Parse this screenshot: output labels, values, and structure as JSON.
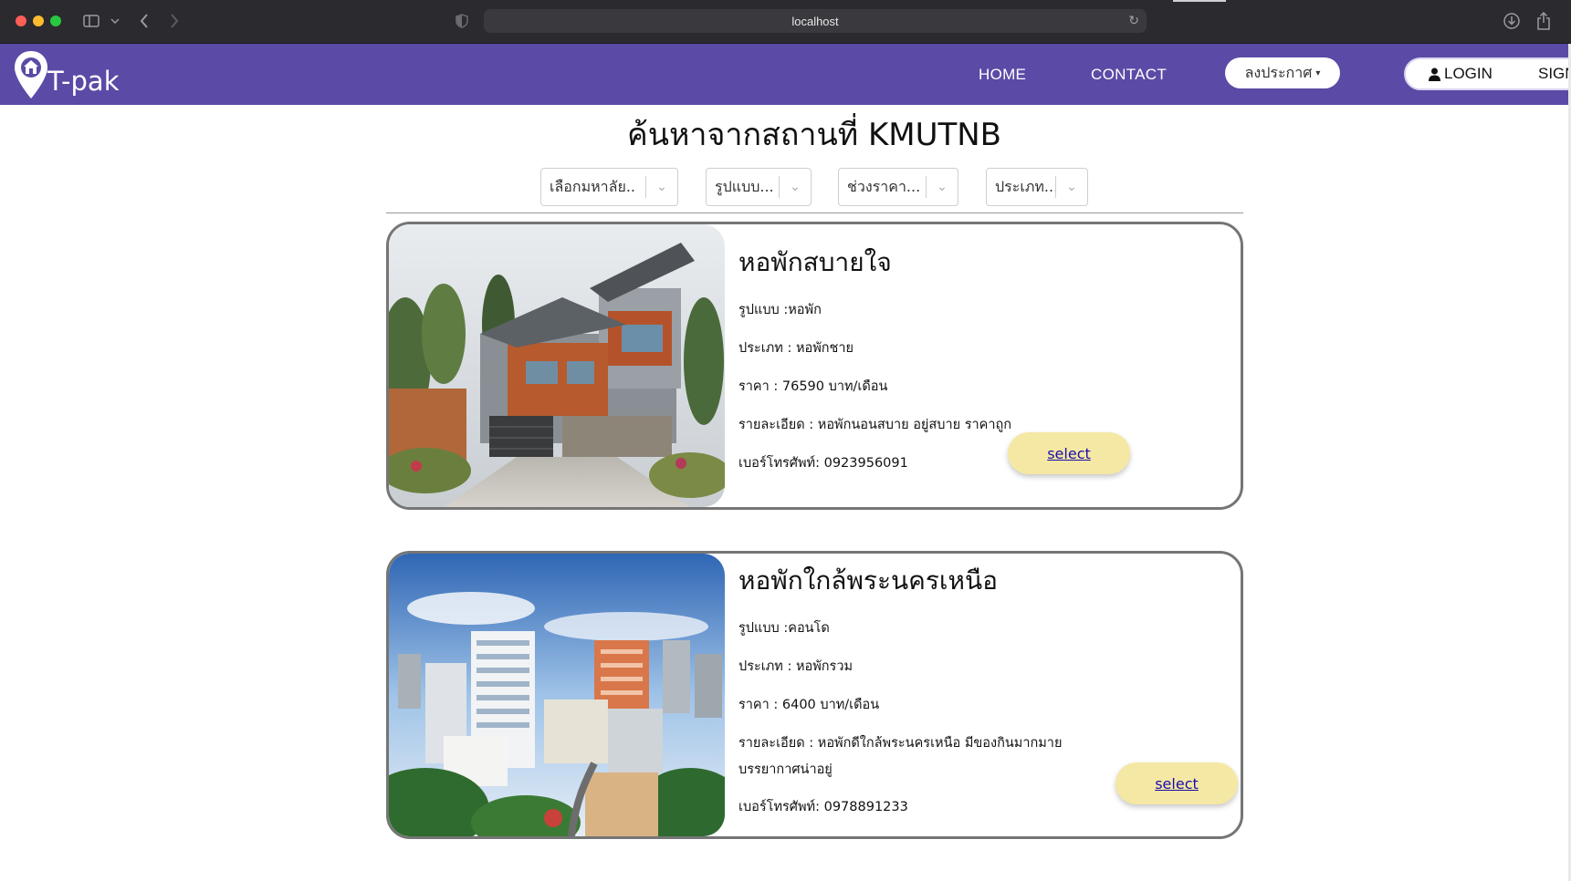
{
  "browser": {
    "url": "localhost",
    "icons": [
      "sidebar-icon",
      "chevron-down-icon",
      "back-icon",
      "forward-icon",
      "shield-icon",
      "reload-icon",
      "download-icon",
      "share-icon"
    ]
  },
  "nav": {
    "brand": "T-pak",
    "home": "HOME",
    "contact": "CONTACT",
    "post_label": "ลงประกาศ",
    "login": "LOGIN",
    "signup": "SIGN",
    "colors": {
      "navbar": "#5b4aa6",
      "select_button": "#f5e8a4"
    }
  },
  "page": {
    "title": "ค้นหาจากสถานที่ KMUTNB"
  },
  "filters": [
    {
      "label": "เลือกมหาลัย.."
    },
    {
      "label": "รูปแบบ..."
    },
    {
      "label": "ช่วงราคา..."
    },
    {
      "label": "ประเภท..."
    }
  ],
  "listings": [
    {
      "name": "หอพักสบายใจ",
      "style": "รูปแบบ :หอพัก",
      "type": "ประเภท : หอพักชาย",
      "price": "ราคา : 76590 บาท/เดือน",
      "detail": "รายละเอียด : หอพักนอนสบาย อยู่สบาย ราคาถูก",
      "detail2": "",
      "phone": "เบอร์โทรศัพท์: 0923956091",
      "select": "select"
    },
    {
      "name": "หอพักใกล้พระนครเหนือ",
      "style": "รูปแบบ :คอนโด",
      "type": "ประเภท : หอพักรวม",
      "price": "ราคา : 6400 บาท/เดือน",
      "detail": "รายละเอียด : หอพักดีใกล้พระนครเหนือ มีของกินมากมาย",
      "detail2": "บรรยากาศน่าอยู่",
      "phone": "เบอร์โทรศัพท์: 0978891233",
      "select": "select"
    }
  ]
}
